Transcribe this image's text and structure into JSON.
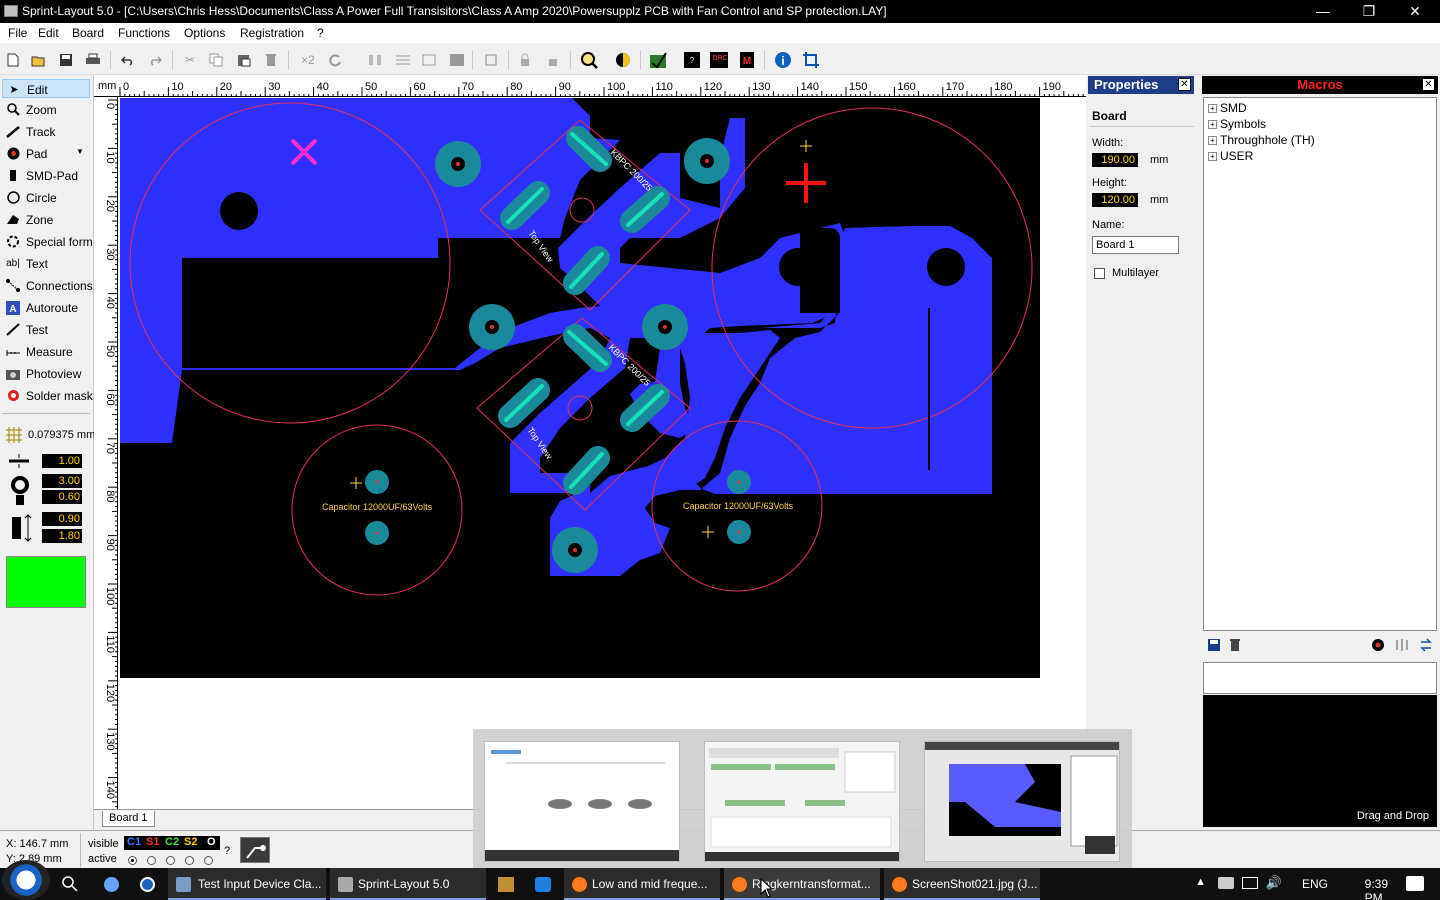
{
  "window": {
    "title": "Sprint-Layout 5.0 - [C:\\Users\\Chris Hess\\Documents\\Class A Power Full Transisitors\\Class A Amp 2020\\Powersupplz PCB with Fan Control and SP protection.LAY]",
    "minimize": "—",
    "maximize": "❐",
    "close": "✕"
  },
  "menu": [
    "File",
    "Edit",
    "Board",
    "Functions",
    "Options",
    "Registration",
    "?"
  ],
  "toolbar": {
    "icons": [
      "new-icon",
      "open-icon",
      "save-icon",
      "print-icon",
      "undo-icon",
      "redo-icon",
      "cut-icon",
      "copy-icon",
      "paste-icon",
      "delete-icon",
      "duplicate-icon",
      "rotate-icon",
      "mirror-h-icon",
      "align-icon",
      "group-icon",
      "grid-icon",
      "layer-icon",
      "lock-icon",
      "unlock-icon",
      "zoom-icon",
      "transparent-icon",
      "drc-check-icon",
      "drc-icon",
      "drc-2-icon",
      "macro-icon",
      "info-icon",
      "crop-icon"
    ],
    "duplicate_label": "×2"
  },
  "tools": {
    "items": [
      {
        "label": "Edit",
        "icon": "cursor-icon",
        "active": true
      },
      {
        "label": "Zoom",
        "icon": "magnifier-icon"
      },
      {
        "label": "Track",
        "icon": "track-icon"
      },
      {
        "label": "Pad",
        "icon": "pad-icon"
      },
      {
        "label": "SMD-Pad",
        "icon": "smd-pad-icon"
      },
      {
        "label": "Circle",
        "icon": "circle-icon"
      },
      {
        "label": "Zone",
        "icon": "zone-icon"
      },
      {
        "label": "Special form",
        "icon": "special-form-icon"
      },
      {
        "label": "Text",
        "icon": "text-icon"
      },
      {
        "label": "Connections",
        "icon": "connections-icon"
      },
      {
        "label": "Autoroute",
        "icon": "autoroute-icon"
      },
      {
        "label": "Test",
        "icon": "test-icon"
      },
      {
        "label": "Measure",
        "icon": "measure-icon"
      },
      {
        "label": "Photoview",
        "icon": "photoview-icon"
      },
      {
        "label": "Solder mask",
        "icon": "solder-mask-icon"
      }
    ],
    "grid_value": "0.079375 mm",
    "track_width": "1.00",
    "pad_outer": "3.00",
    "pad_inner": "0.60",
    "smd_w": "0.90",
    "smd_h": "1.80",
    "color": "#00ff00"
  },
  "ruler": {
    "unit": "mm",
    "h_ticks": [
      "0",
      "10",
      "20",
      "30",
      "40",
      "50",
      "60",
      "70",
      "80",
      "90",
      "100",
      "110",
      "120",
      "130",
      "140",
      "150",
      "160",
      "170",
      "180",
      "190"
    ],
    "v_ticks": [
      "0",
      "10",
      "20",
      "30",
      "40",
      "50",
      "60",
      "70",
      "80",
      "90",
      "100",
      "110",
      "120",
      "130",
      "140"
    ]
  },
  "pcb": {
    "component_labels": [
      "KBPC 200/25",
      "Top View",
      "KBPC 200/25",
      "Top View",
      "Capacitor 12000UF/63Volts",
      "Capacitor 12000UF/63Volts"
    ],
    "colors": {
      "board": "#000000",
      "copper": "#2f2fff",
      "pad": "#1a8a9a",
      "outline": "#e0305a",
      "silk": "#ffffff"
    }
  },
  "board_tab": "Board 1",
  "properties": {
    "header": "Properties",
    "section": "Board",
    "width_label": "Width:",
    "width": "190.00",
    "height_label": "Height:",
    "height": "120.00",
    "unit": "mm",
    "name_label": "Name:",
    "name": "Board 1",
    "multilayer": "Multilayer"
  },
  "macros": {
    "header": "Macros",
    "tree": [
      "SMD",
      "Symbols",
      "Throughhole (TH)",
      "USER"
    ],
    "drag_drop": "Drag and Drop"
  },
  "status": {
    "x": "X:  146.7 mm",
    "y": "Y:  2.89 mm",
    "visible": "visible",
    "active": "active",
    "layers": [
      "C1",
      "S1",
      "C2",
      "S2",
      "O"
    ],
    "help": "?"
  },
  "taskbar": {
    "items": [
      {
        "label": "Test Input Device Cla..."
      },
      {
        "label": "Sprint-Layout 5.0"
      },
      {
        "label": "Low and mid freque..."
      },
      {
        "label": "Ringkerntransformat..."
      },
      {
        "label": "ScreenShot021.jpg (J..."
      }
    ],
    "lang": "ENG",
    "time": "9:39 PM"
  }
}
